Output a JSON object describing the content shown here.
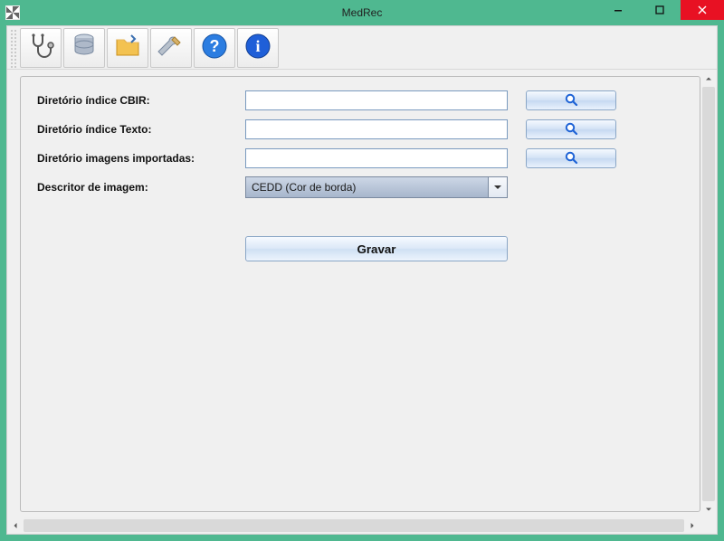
{
  "window": {
    "title": "MedRec"
  },
  "toolbar_icons": [
    "stethoscope-icon",
    "database-icon",
    "folder-icon",
    "tools-icon",
    "help-icon",
    "info-icon"
  ],
  "form": {
    "rows": [
      {
        "label": "Diretório índice CBIR:",
        "value": ""
      },
      {
        "label": "Diretório índice Texto:",
        "value": ""
      },
      {
        "label": "Diretório imagens importadas:",
        "value": ""
      }
    ],
    "descriptor": {
      "label": "Descritor de imagem:",
      "selected": "CEDD (Cor de borda)"
    },
    "save_label": "Gravar"
  }
}
